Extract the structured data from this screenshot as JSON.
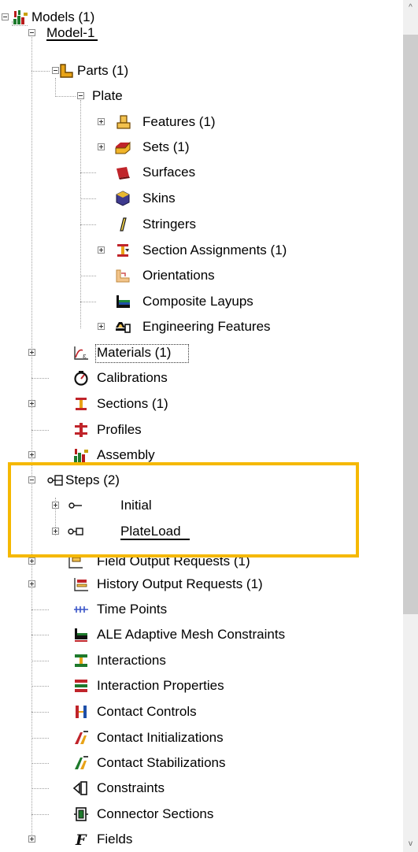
{
  "tree": {
    "models": "Models (1)",
    "model1": "Model-1",
    "parts": "Parts (1)",
    "plate": "Plate",
    "features": "Features (1)",
    "sets": "Sets (1)",
    "surfaces": "Surfaces",
    "skins": "Skins",
    "stringers": "Stringers",
    "section_assignments": "Section Assignments (1)",
    "orientations": "Orientations",
    "composite_layups": "Composite Layups",
    "engineering_features": "Engineering Features",
    "materials": "Materials (1)",
    "calibrations": "Calibrations",
    "sections": "Sections (1)",
    "profiles": "Profiles",
    "assembly": "Assembly",
    "steps": "Steps (2)",
    "initial": "Initial",
    "plateload": "PlateLoad",
    "field_output": "Field Output Requests (1)",
    "history_output": "History Output Requests (1)",
    "time_points": "Time Points",
    "ale": "ALE Adaptive Mesh Constraints",
    "interactions": "Interactions",
    "interaction_properties": "Interaction Properties",
    "contact_controls": "Contact Controls",
    "contact_initializations": "Contact Initializations",
    "contact_stabilizations": "Contact Stabilizations",
    "constraints": "Constraints",
    "connector_sections": "Connector Sections",
    "fields": "Fields"
  },
  "scrollbar": {
    "up_arrow": "^",
    "down_arrow": "v"
  },
  "icons": {
    "models": "models-icon",
    "parts": "parts-icon",
    "features": "features-icon",
    "sets": "sets-icon",
    "surfaces": "surfaces-icon",
    "skins": "skins-icon",
    "stringers": "stringers-icon",
    "section_assignments": "section-assignments-icon",
    "orientations": "orientations-icon",
    "composite_layups": "composite-layups-icon",
    "engineering_features": "engineering-features-icon",
    "materials": "materials-icon",
    "calibrations": "calibrations-icon",
    "sections": "sections-icon",
    "profiles": "profiles-icon",
    "assembly": "assembly-icon",
    "steps": "steps-icon",
    "initial": "initial-step-icon",
    "plateload": "step-icon",
    "field_output": "field-output-icon",
    "history_output": "history-output-icon",
    "time_points": "time-points-icon",
    "ale": "ale-icon",
    "interactions": "interactions-icon",
    "interaction_properties": "interaction-properties-icon",
    "contact_controls": "contact-controls-icon",
    "contact_initializations": "contact-initializations-icon",
    "contact_stabilizations": "contact-stabilizations-icon",
    "constraints": "constraints-icon",
    "connector_sections": "connector-sections-icon",
    "fields": "fields-icon"
  },
  "colors": {
    "highlight_border": "#f5b800",
    "scrollbar_track": "#f0f0f0",
    "scrollbar_thumb": "#cdcdcd"
  }
}
